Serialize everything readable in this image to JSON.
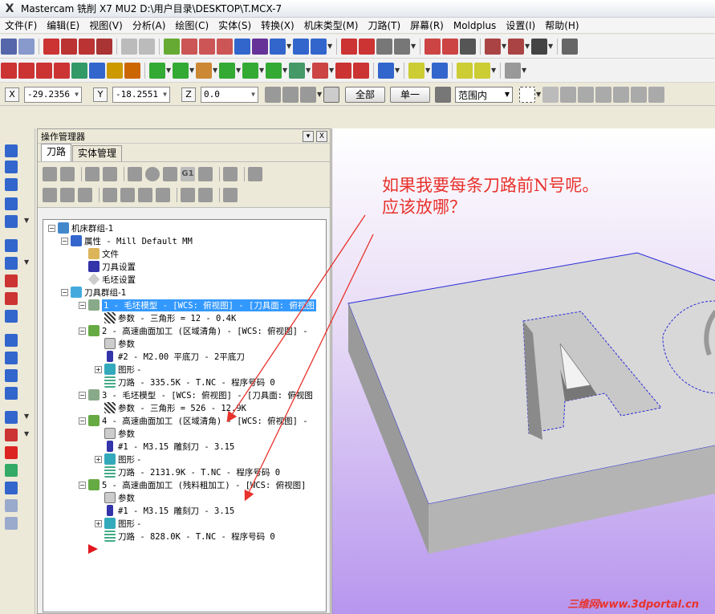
{
  "window": {
    "title": "Mastercam 铣削 X7 MU2  D:\\用户目录\\DESKTOP\\T.MCX-7"
  },
  "menu": [
    "文件(F)",
    "编辑(E)",
    "视图(V)",
    "分析(A)",
    "绘图(C)",
    "实体(S)",
    "转换(X)",
    "机床类型(M)",
    "刀路(T)",
    "屏幕(R)",
    "Moldplus",
    "设置(I)",
    "帮助(H)"
  ],
  "coords": {
    "x_label": "X",
    "x_value": "-29.2356",
    "y_label": "Y",
    "y_value": "-18.2551",
    "z_label": "Z",
    "z_value": "0.0",
    "all_button": "全部",
    "single_button": "单一",
    "range_select": "范围内"
  },
  "ops_manager": {
    "title": "操作管理器",
    "close_label": "X",
    "tabs": [
      "刀路",
      "实体管理"
    ],
    "tree": {
      "machine_group": "机床群组-1",
      "properties": "属性 - Mill Default MM",
      "files": "文件",
      "tool_settings": "刀具设置",
      "stock_settings": "毛坯设置",
      "toolpath_group": "刀具群组-1",
      "op1": "1 - 毛坯模型 - [WCS: 俯视图] - [刀具面: 俯视图",
      "op1_params": "参数 - 三角形 =  12 - 0.4K",
      "op2": "2 - 高速曲面加工 (区域清角) - [WCS: 俯视图] -",
      "op2_params": "参数",
      "op2_tool": "#2 - M2.00 平底刀 - 2平底刀",
      "op2_geo": "图形 -",
      "op2_path": "刀路 - 335.5K - T.NC - 程序号码 0",
      "op3": "3 - 毛坯模型 - [WCS: 俯视图] - [刀具面: 俯视图",
      "op3_params": "参数 - 三角形 =  526 - 12.9K",
      "op4": "4 - 高速曲面加工 (区域清角) - [WCS: 俯视图] -",
      "op4_params": "参数",
      "op4_tool": "#1 - M3.15 雕刻刀 - 3.15",
      "op4_geo": "图形 -",
      "op4_path": "刀路 - 2131.9K - T.NC - 程序号码 0",
      "op5": "5 - 高速曲面加工 (残料粗加工) - [WCS: 俯视图]",
      "op5_params": "参数",
      "op5_tool": "#1 - M3.15 雕刻刀 - 3.15",
      "op5_geo": "图形 -",
      "op5_path": "刀路 - 828.0K - T.NC - 程序号码 0"
    }
  },
  "annotation": {
    "line1": "如果我要每条刀路前N号呢。",
    "line2": "应该放哪？",
    "watermark": "三维网www.3dportal.cn"
  },
  "colors": {
    "accent_red": "#e8322c",
    "selection": "#3399ff",
    "part_outline": "#2a2ad8"
  }
}
